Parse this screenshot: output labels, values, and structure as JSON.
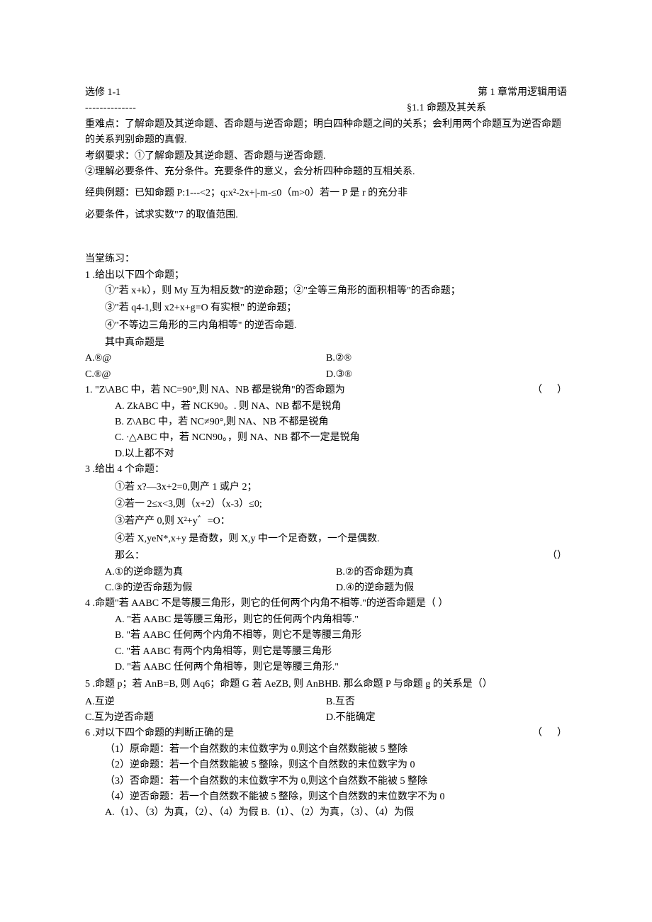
{
  "header": {
    "left": "选修 1-1",
    "right": "第 1 章常用逻辑用语"
  },
  "dashes": "--------------",
  "subtitle": "§1.1 命题及其关系",
  "zhong1": "重难点：了解命题及其逆命题、否命题与逆否命题；明白四种命题之间的关系；会利用两个命题互为逆否命题的关系判别命题的真假.",
  "kaogang": "考纲要求：①了解命题及其逆命题、否命题与逆否命题.",
  "kaogang2": "②理解必要条件、充分条件。充要条件的意义，会分析四种命题的互相关系.",
  "liti1": "经典例题：已知命题 P:1---<2；q:x²-2x+|-m-≤0（m>0）若一 P 是 r 的充分非",
  "liti2": "必要条件，试求实数\"7 的取值范围.",
  "dangtang": "当堂练习：",
  "q1": {
    "lead": "1 .给出以下四个命题；",
    "a": "①\"若 x+k），则 My 互为相反数\"的逆命题；②\"全等三角形的面积相等\"的否命题；",
    "b": "③\"若 q4-1,则 x2+x+g=O 有实根\" 的逆命题；",
    "c": "④\"不等边三角形的三内角相等\" 的逆否命题.",
    "d": "其中真命题是",
    "oA": "A.®@",
    "oB": "B.②®",
    "oC": "C.®@",
    "oD": "D.③®"
  },
  "q2": {
    "lead": "1.  \"Z\\ABC 中，若 NC=90°,则 NA、NB 都是锐角\"的否命题为",
    "paren": "（      ）",
    "a": "A.  ZkABC 中，若 NCK90。. 则 NA、NB 都不是锐角",
    "b": "B.  Z\\ABC 中，若 NC≠90°,则 NA、NB 不都是锐角",
    "c": "C.  ∙△ABC 中，若 NCN90。，则 NA、NB 都不一定是锐角",
    "d": "D.以上都不对"
  },
  "q3": {
    "lead": "3  .给出 4 个命题：",
    "a": "①若 x?—3x+2=0,则产 1 或户 2；",
    "b": "②若一 2≤x<3,则（x+2）（x-3）≤0;",
    "c": "③若产产 0,则 X²+y゛=O：",
    "d": "④若 X,yeN*,x+y 是奇数，则 X,y 中一个足奇数，一个是偶数.",
    "then": "那么：",
    "paren": "（）",
    "oA": "A.①的逆命题为真",
    "oB": "B.②的否命题为真",
    "oC": "C.③的逆否命题为假",
    "oD": "D.④的逆命题为假"
  },
  "q4": {
    "lead": "4  .命题\"若 AABC 不是等腰三角形，则它的任何两个内角不相等.\"的逆否命题是（       ）",
    "a": "A.  \"若 AABC 是等腰三角形，则它的任何两个内角相等.\"",
    "b": "B.  \"若 AABC 任何两个内角不相等，则它不是等腰三角形",
    "c": "C.  \"若 AABC 有两个内角相等，则它是等腰三角形",
    "d": "D.  \"若 AABC 任何两个角相等，则它是等腰三角形.\""
  },
  "q5": {
    "lead": "5  .命题 p；若 AnB=B, 则 Aq6；命题 G 若 AeZB, 则 AnBHB. 那么命题 P 与命题 g 的关系是（）",
    "oA": "A.互逆",
    "oB": "B.互否",
    "oC": "C.互为逆否命题",
    "oD": "D.不能确定"
  },
  "q6": {
    "lead": "6  .对以下四个命题的判断正确的是",
    "paren": "（      ）",
    "a": "（1）原命题：若一个自然数的末位数字为 0.则这个自然数能被 5 整除",
    "b": "（2）逆命题：若一个自然数能被 5 整除，则这个自然数的末位数字为 0",
    "c": "（3）否命题：若一个自然数的末位数字不为 0,则这个自然数不能被 5 整除",
    "d": "（4）逆否命题：若一个自然数不能被 5 整除，则这个自然数的末位数字不为 0",
    "ans": "A.（1）、（3）为真，（2）、（4）为假 B.（1）、（2）为真，（3）、（4）为假"
  }
}
